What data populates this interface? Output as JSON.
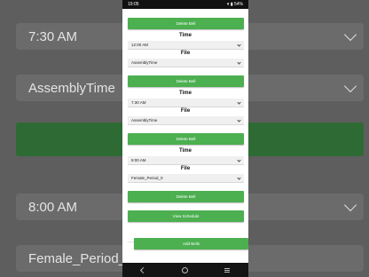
{
  "status_bar": {
    "time": "19:05",
    "icons": [
      "chat-bubble-icon",
      "camera-icon",
      "cloud-icon",
      "dot-icon"
    ],
    "battery": "54%"
  },
  "background": {
    "time_value": "7:30 AM",
    "file_value": "AssemblyTime",
    "time_value_2": "8:00 AM",
    "file_value_2": "Female_Period_0"
  },
  "blocks": [
    {
      "delete_label": "Delete Bell"
    },
    {
      "time_label": "Time",
      "time_value": "12:00 AM",
      "file_label": "File",
      "file_value": "AssemblyTime",
      "delete_label": "Delete Bell"
    },
    {
      "time_label": "Time",
      "time_value": "7:30 AM",
      "file_label": "File",
      "file_value": "AssemblyTime",
      "delete_label": "Delete Bell"
    },
    {
      "time_label": "Time",
      "time_value": "8:00 AM",
      "file_label": "File",
      "file_value": "Female_Period_0",
      "delete_label": "Delete Bell"
    }
  ],
  "actions": {
    "view_schedule": "View Schedule",
    "add_bells": "Add Bells"
  },
  "nav": [
    "back-icon",
    "home-icon",
    "recents-icon"
  ],
  "colors": {
    "accent": "#4caf50",
    "background_dim": "#5e5e5e"
  }
}
